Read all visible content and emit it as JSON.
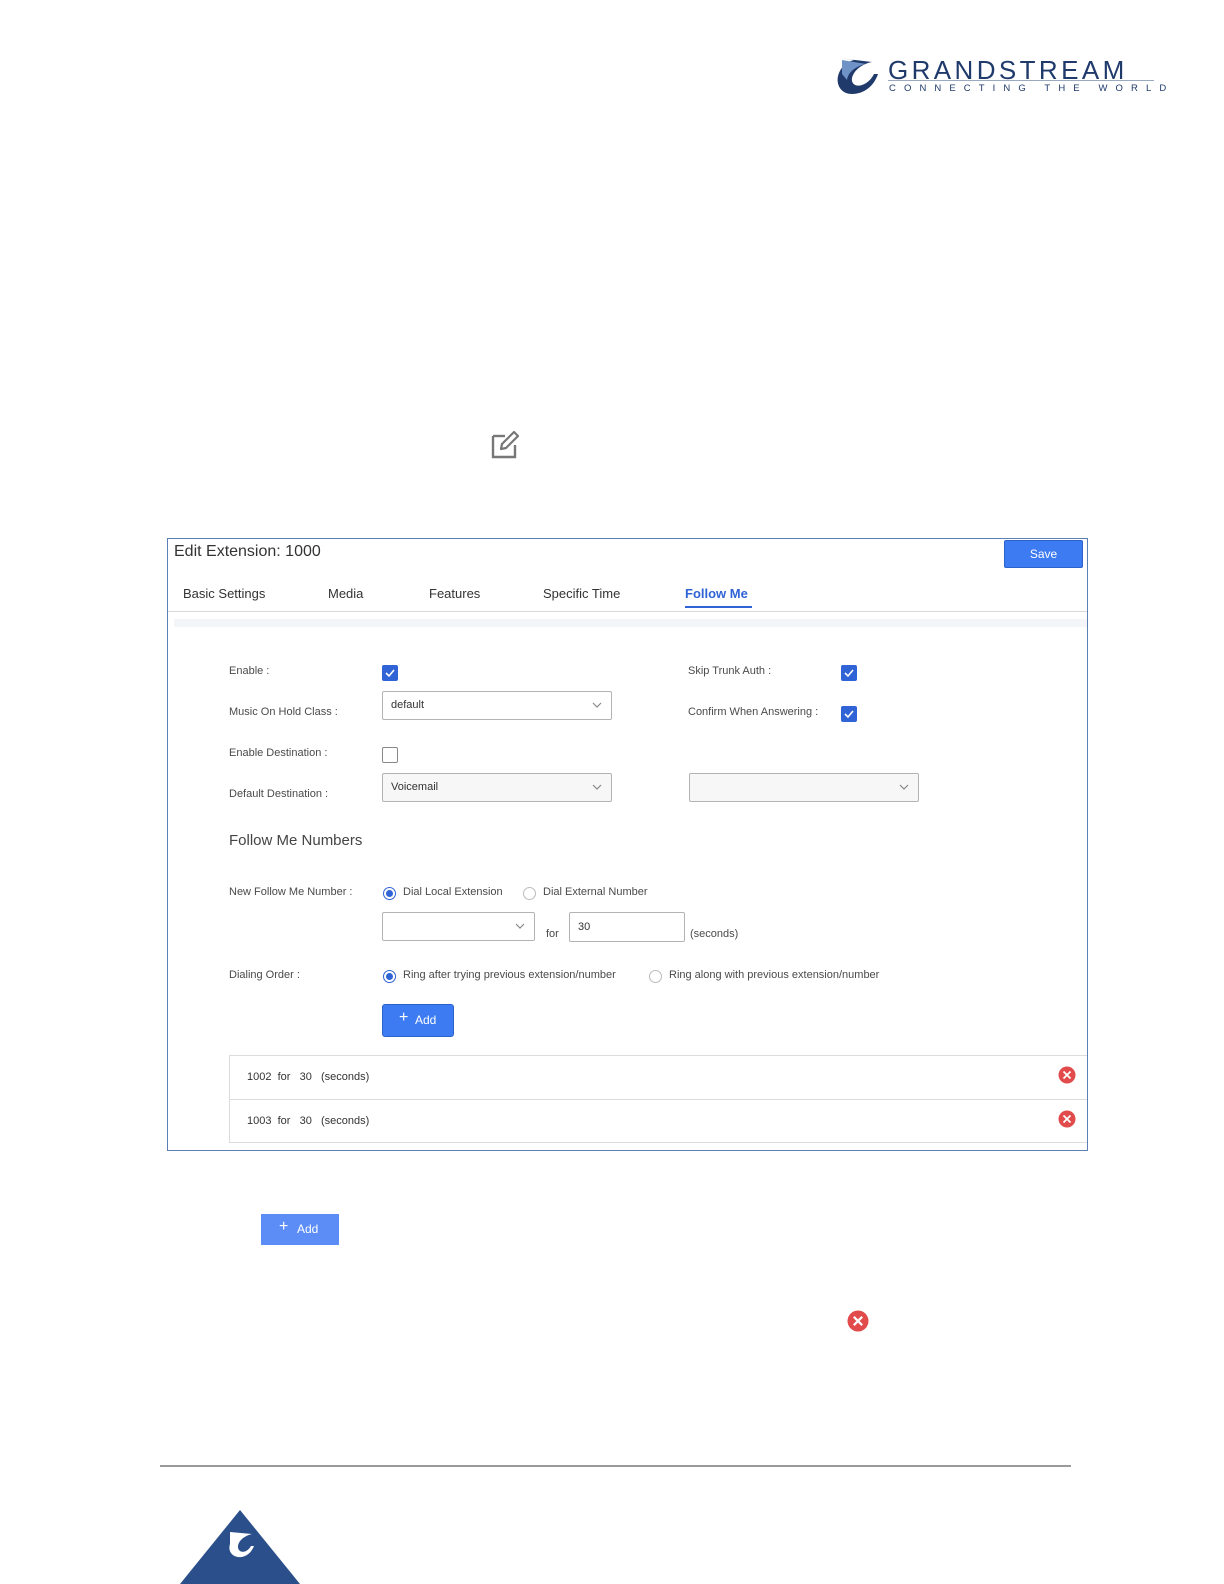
{
  "brand": {
    "name": "GRANDSTREAM",
    "tagline": "CONNECTING THE WORLD",
    "colors": {
      "primary": "#1f3a6b",
      "accent": "#3d7bf2"
    }
  },
  "dialog": {
    "title": "Edit Extension: 1000",
    "save_label": "Save",
    "tabs": [
      {
        "label": "Basic Settings",
        "active": false
      },
      {
        "label": "Media",
        "active": false
      },
      {
        "label": "Features",
        "active": false
      },
      {
        "label": "Specific Time",
        "active": false
      },
      {
        "label": "Follow Me",
        "active": true
      }
    ],
    "form": {
      "enable": {
        "label": "Enable :",
        "checked": true
      },
      "skip_trunk_auth": {
        "label": "Skip Trunk Auth :",
        "checked": true
      },
      "music_on_hold": {
        "label": "Music On Hold Class :",
        "value": "default"
      },
      "confirm_when_answering": {
        "label": "Confirm When Answering :",
        "checked": true
      },
      "enable_destination": {
        "label": "Enable Destination :",
        "checked": false
      },
      "default_destination": {
        "label": "Default Destination :",
        "value": "Voicemail",
        "secondary_value": ""
      }
    },
    "follow_me": {
      "section_title": "Follow Me Numbers",
      "new_number_label": "New Follow Me Number :",
      "radio_local": "Dial Local Extension",
      "radio_external": "Dial External Number",
      "selected_mode": "local",
      "number_select_value": "",
      "for_label": "for",
      "seconds_value": "30",
      "seconds_unit": "(seconds)",
      "dialing_order_label": "Dialing Order :",
      "order_after": "Ring after trying previous extension/number",
      "order_along": "Ring along with previous extension/number",
      "selected_order": "after",
      "add_label": "Add",
      "entries": [
        {
          "text": "1002  for   30   (seconds)"
        },
        {
          "text": "1003  for   30   (seconds)"
        }
      ]
    }
  },
  "standalone_add_label": "Add",
  "icons": {
    "edit": "edit-icon",
    "delete": "delete-circle-icon",
    "chevron": "chevron-down-icon",
    "check": "check-icon"
  }
}
